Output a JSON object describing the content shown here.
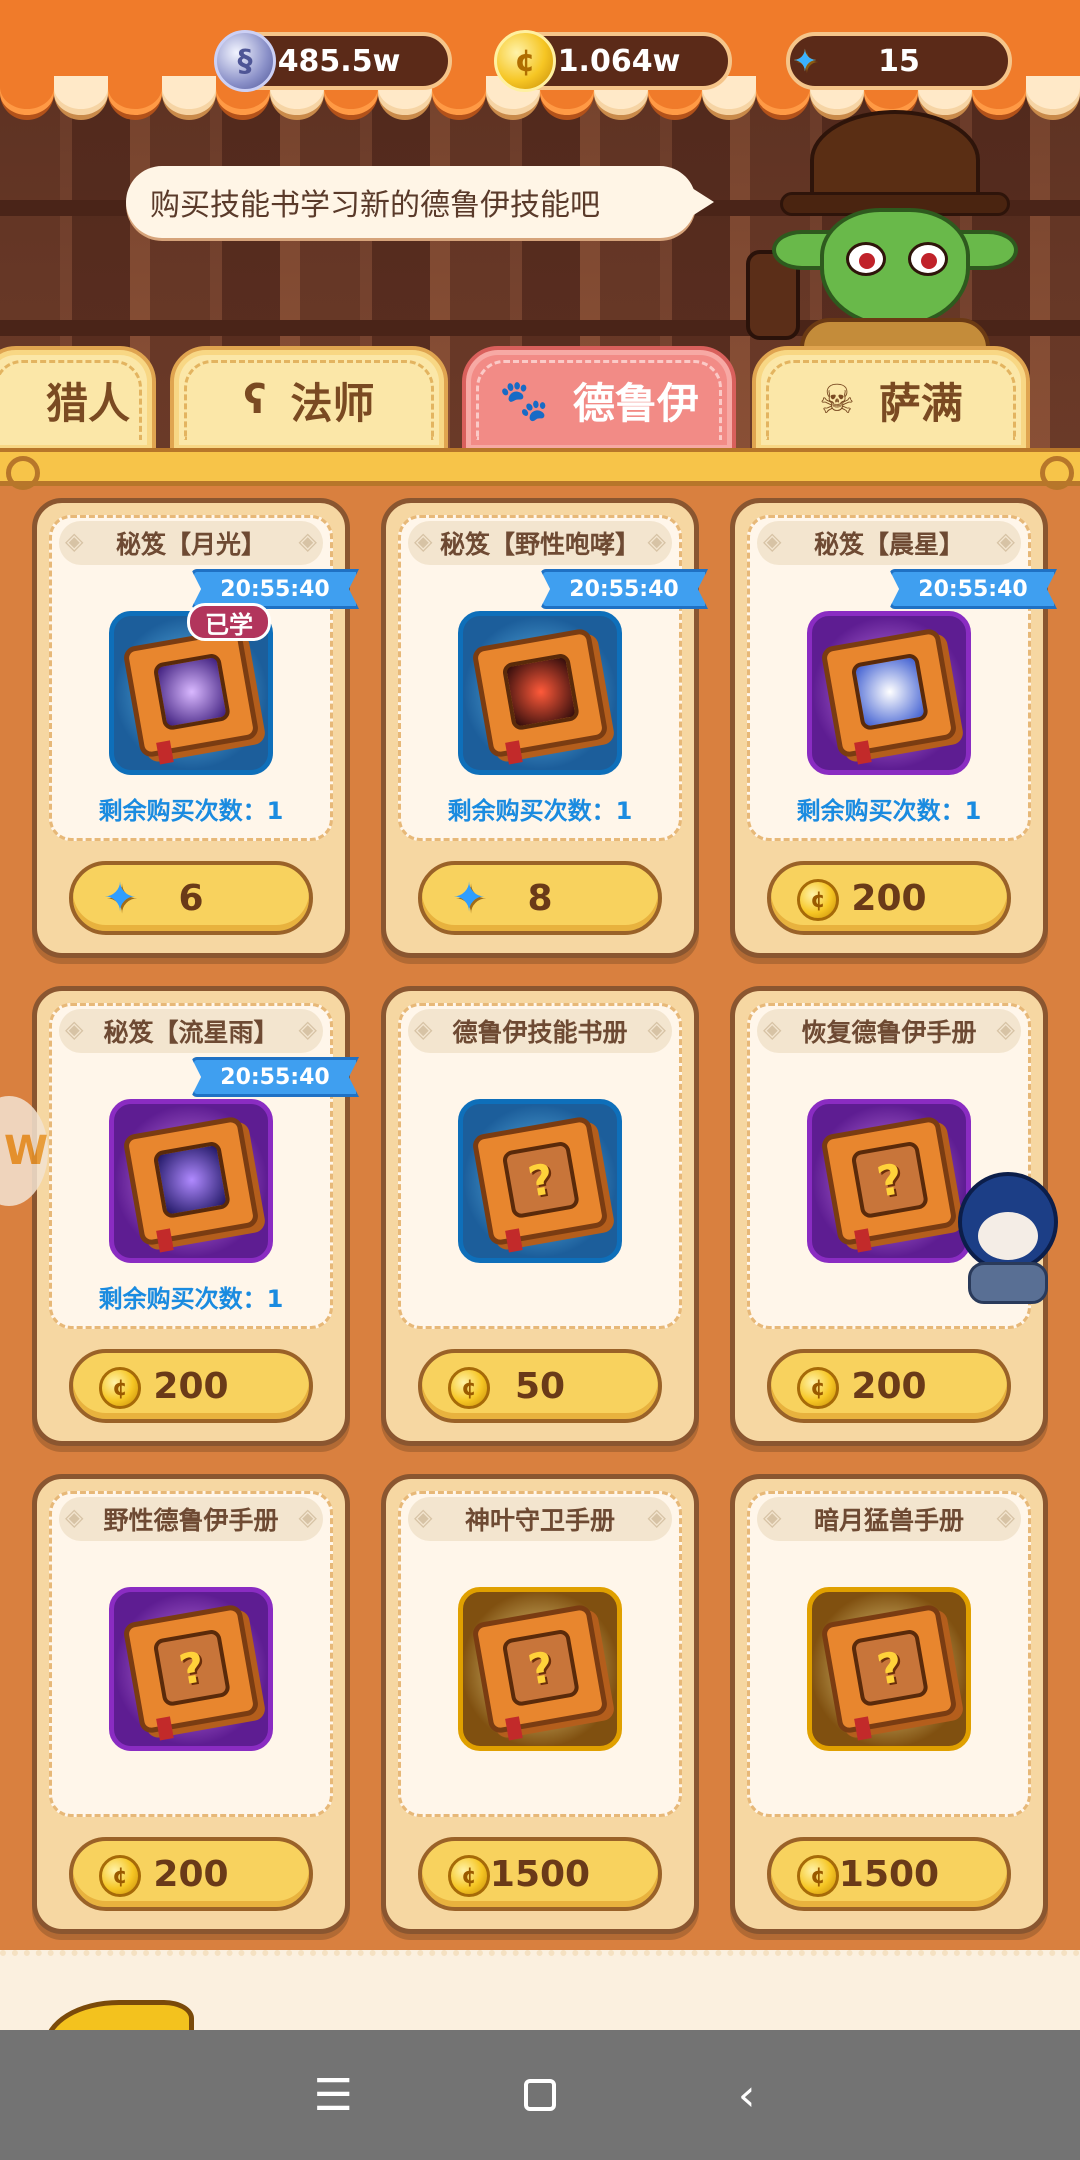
{
  "currencies": [
    {
      "id": "silver",
      "icon": "silver-coin-icon",
      "value": "485.5w"
    },
    {
      "id": "gold",
      "icon": "gold-coin-icon",
      "value": "1.064w"
    },
    {
      "id": "gem",
      "icon": "star-gem-icon",
      "value": "15"
    }
  ],
  "npc": {
    "speech": "购买技能书学习新的德鲁伊技能吧"
  },
  "tabs": [
    {
      "label": "猎人",
      "icon": "bow-icon",
      "active": false
    },
    {
      "label": "法师",
      "icon": "staff-icon",
      "active": false
    },
    {
      "label": "德鲁伊",
      "icon": "paw-icon",
      "active": true
    },
    {
      "label": "萨满",
      "icon": "skull-icon",
      "active": false
    }
  ],
  "items": [
    {
      "title": "秘笈【月光】",
      "timer": "20:55:40",
      "learned": "已学",
      "remaining": "剩余购买次数：1",
      "price": "6",
      "currency": "gem",
      "frame": "blue",
      "emblem": "moon"
    },
    {
      "title": "秘笈【野性咆哮】",
      "timer": "20:55:40",
      "learned": "",
      "remaining": "剩余购买次数：1",
      "price": "8",
      "currency": "gem",
      "frame": "blue",
      "emblem": "roar"
    },
    {
      "title": "秘笈【晨星】",
      "timer": "20:55:40",
      "learned": "",
      "remaining": "剩余购买次数：1",
      "price": "200",
      "currency": "coin",
      "frame": "purple",
      "emblem": "star"
    },
    {
      "title": "秘笈【流星雨】",
      "timer": "20:55:40",
      "learned": "",
      "remaining": "剩余购买次数：1",
      "price": "200",
      "currency": "coin",
      "frame": "purple",
      "emblem": "meteor"
    },
    {
      "title": "德鲁伊技能书册",
      "timer": "",
      "learned": "",
      "remaining": "",
      "price": "50",
      "currency": "coin",
      "frame": "blue",
      "emblem": "quest"
    },
    {
      "title": "恢复德鲁伊手册",
      "timer": "",
      "learned": "",
      "remaining": "",
      "price": "200",
      "currency": "coin",
      "frame": "purple",
      "emblem": "quest"
    },
    {
      "title": "野性德鲁伊手册",
      "timer": "",
      "learned": "",
      "remaining": "",
      "price": "200",
      "currency": "coin",
      "frame": "purple",
      "emblem": "quest"
    },
    {
      "title": "神叶守卫手册",
      "timer": "",
      "learned": "",
      "remaining": "",
      "price": "1500",
      "currency": "coin",
      "frame": "gold",
      "emblem": "quest"
    },
    {
      "title": "暗月猛兽手册",
      "timer": "",
      "learned": "",
      "remaining": "",
      "price": "1500",
      "currency": "coin",
      "frame": "gold",
      "emblem": "quest"
    }
  ],
  "navbar": {
    "menu_icon": "menu-icon",
    "home_icon": "home-icon",
    "back_icon": "back-icon"
  }
}
